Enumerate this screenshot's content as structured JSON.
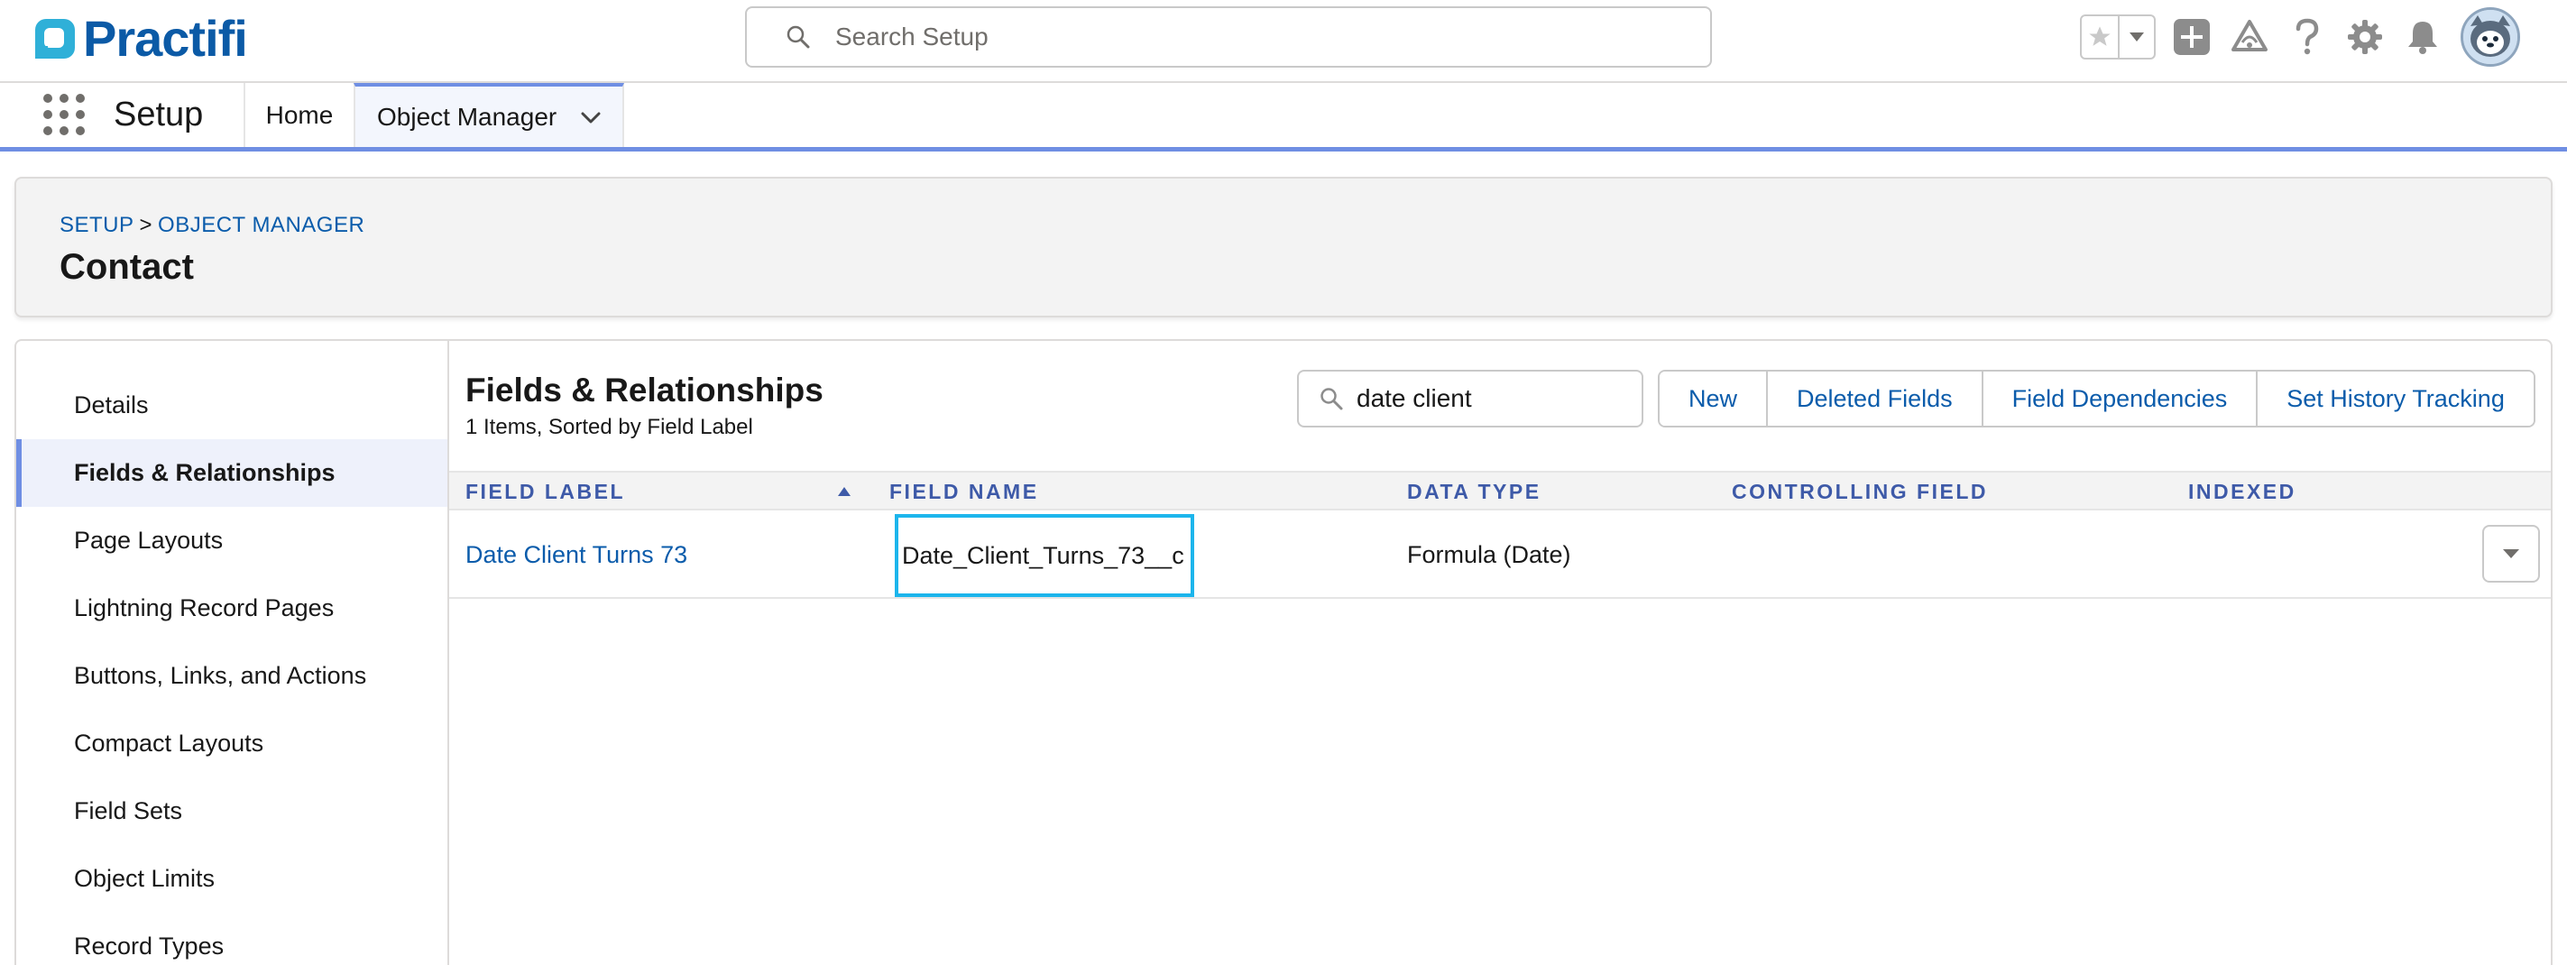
{
  "brand": {
    "name": "Practifi",
    "color": "#0b5aa6"
  },
  "global_search": {
    "placeholder": "Search Setup"
  },
  "header_icons": [
    "favorites-star-icon",
    "favorites-dropdown-icon",
    "add-icon",
    "trailhead-icon",
    "help-icon",
    "setup-gear-icon",
    "notifications-bell-icon",
    "avatar"
  ],
  "app_nav": {
    "app_name": "Setup",
    "tabs": [
      {
        "label": "Home"
      },
      {
        "label": "Object Manager",
        "active": true
      }
    ]
  },
  "page_header": {
    "breadcrumb": [
      "SETUP",
      "OBJECT MANAGER"
    ],
    "breadcrumb_separator": ">",
    "title": "Contact"
  },
  "sidebar": {
    "items": [
      {
        "label": "Details"
      },
      {
        "label": "Fields & Relationships",
        "active": true
      },
      {
        "label": "Page Layouts"
      },
      {
        "label": "Lightning Record Pages"
      },
      {
        "label": "Buttons, Links, and Actions"
      },
      {
        "label": "Compact Layouts"
      },
      {
        "label": "Field Sets"
      },
      {
        "label": "Object Limits"
      },
      {
        "label": "Record Types"
      }
    ]
  },
  "content": {
    "title": "Fields & Relationships",
    "subtitle": "1 Items, Sorted by Field Label",
    "quick_find_value": "date client",
    "buttons": [
      "New",
      "Deleted Fields",
      "Field Dependencies",
      "Set History Tracking"
    ],
    "table": {
      "columns": [
        "FIELD LABEL",
        "FIELD NAME",
        "DATA TYPE",
        "CONTROLLING FIELD",
        "INDEXED"
      ],
      "sorted_by": "FIELD LABEL",
      "sort_direction": "ascending",
      "rows": [
        {
          "field_label": "Date Client Turns 73",
          "field_name": "Date_Client_Turns_73__c",
          "data_type": "Formula (Date)",
          "controlling_field": "",
          "indexed": ""
        }
      ]
    }
  },
  "colors": {
    "link": "#0b5cab",
    "accent": "#6f8ee3",
    "highlight": "#1cb5ec"
  }
}
